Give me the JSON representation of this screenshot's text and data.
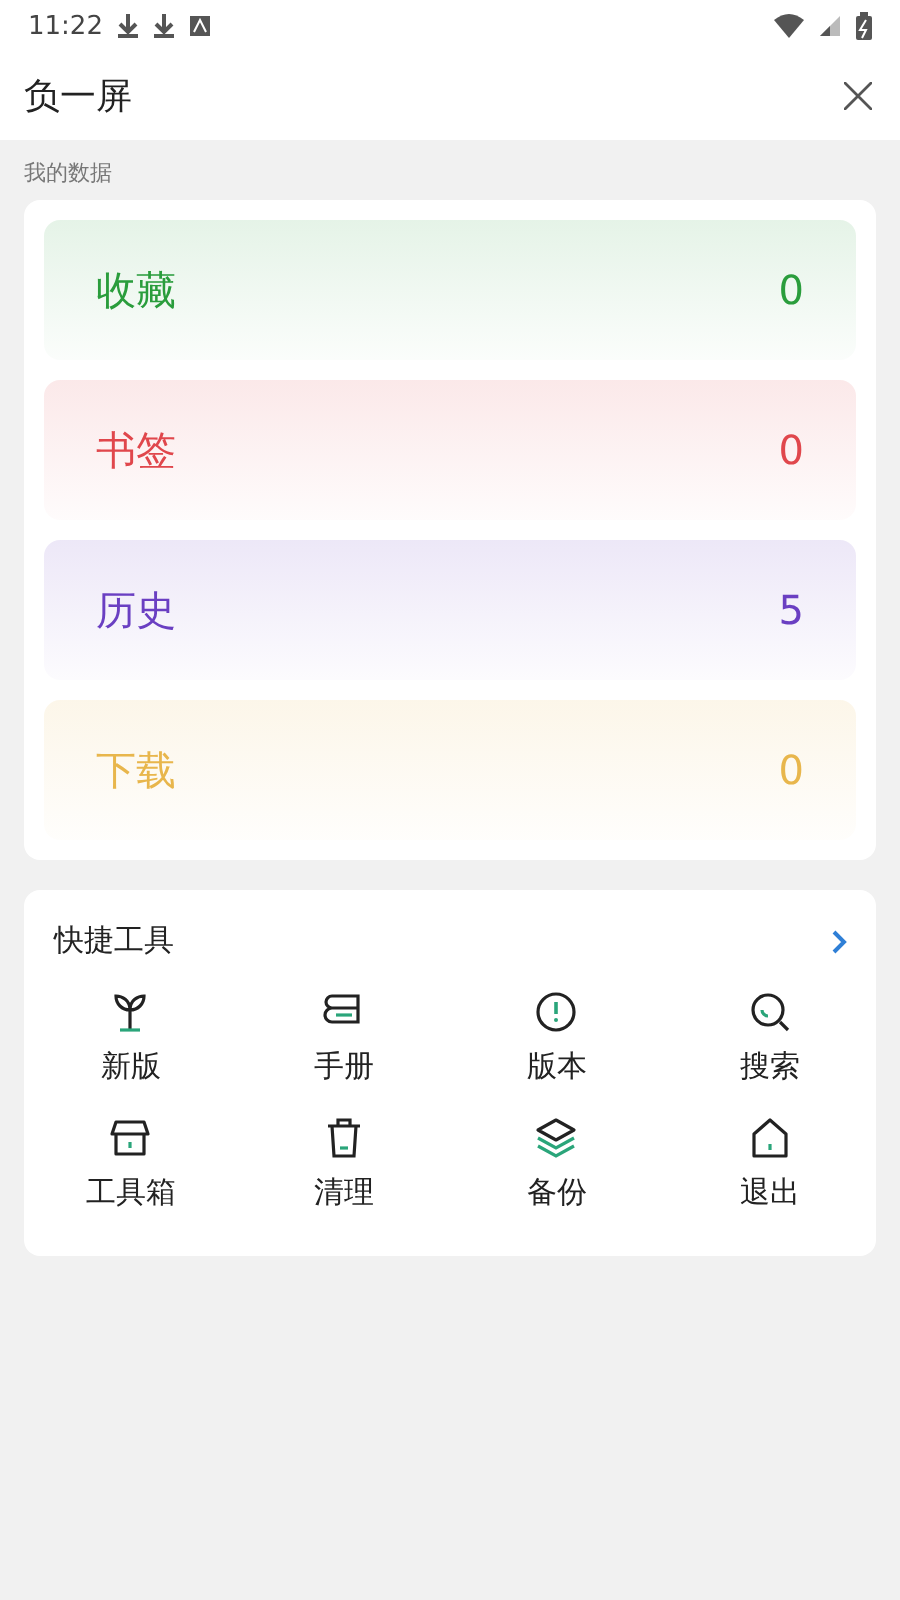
{
  "status_bar": {
    "time": "11:22"
  },
  "header": {
    "title": "负一屏"
  },
  "data_section": {
    "label": "我的数据",
    "items": [
      {
        "label": "收藏",
        "count": "0",
        "color": "#2a9d3c"
      },
      {
        "label": "书签",
        "count": "0",
        "color": "#e0474c"
      },
      {
        "label": "历史",
        "count": "5",
        "color": "#6a3fc2"
      },
      {
        "label": "下载",
        "count": "0",
        "color": "#e8b64c"
      }
    ]
  },
  "tools": {
    "title": "快捷工具",
    "items": [
      {
        "label": "新版",
        "kind": "sprout"
      },
      {
        "label": "手册",
        "kind": "book"
      },
      {
        "label": "版本",
        "kind": "info"
      },
      {
        "label": "搜索",
        "kind": "search"
      },
      {
        "label": "工具箱",
        "kind": "shop"
      },
      {
        "label": "清理",
        "kind": "trash"
      },
      {
        "label": "备份",
        "kind": "layers"
      },
      {
        "label": "退出",
        "kind": "home"
      }
    ]
  }
}
